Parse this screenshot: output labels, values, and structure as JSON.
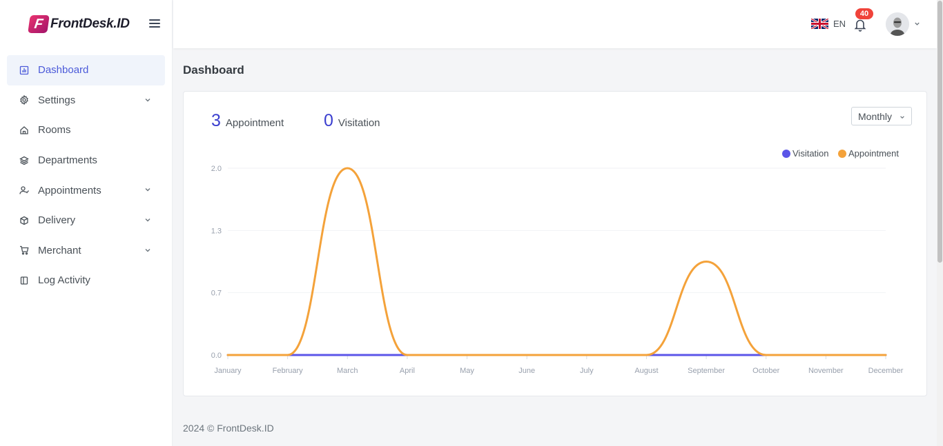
{
  "brand": {
    "logo_letter": "F",
    "name": "FrontDesk.ID"
  },
  "sidebar": {
    "items": [
      {
        "label": "Dashboard",
        "icon": "chart-bar-icon",
        "active": true,
        "has_children": false
      },
      {
        "label": "Settings",
        "icon": "gear-icon",
        "active": false,
        "has_children": true
      },
      {
        "label": "Rooms",
        "icon": "home-icon",
        "active": false,
        "has_children": false
      },
      {
        "label": "Departments",
        "icon": "layers-icon",
        "active": false,
        "has_children": false
      },
      {
        "label": "Appointments",
        "icon": "user-check-icon",
        "active": false,
        "has_children": true
      },
      {
        "label": "Delivery",
        "icon": "package-icon",
        "active": false,
        "has_children": true
      },
      {
        "label": "Merchant",
        "icon": "cart-icon",
        "active": false,
        "has_children": true
      },
      {
        "label": "Log Activity",
        "icon": "book-icon",
        "active": false,
        "has_children": false
      }
    ]
  },
  "topbar": {
    "language": "EN",
    "language_flag": "uk-flag-icon",
    "notification_count": "40"
  },
  "main": {
    "page_title": "Dashboard",
    "stats": [
      {
        "value": "3",
        "label": "Appointment"
      },
      {
        "value": "0",
        "label": "Visitation"
      }
    ],
    "period_select": "Monthly"
  },
  "chart_data": {
    "type": "line",
    "categories": [
      "January",
      "February",
      "March",
      "April",
      "May",
      "June",
      "July",
      "August",
      "September",
      "October",
      "November",
      "December"
    ],
    "y_ticks": [
      "0.0",
      "0.7",
      "1.3",
      "2.0"
    ],
    "ylim": [
      0,
      2
    ],
    "grid": true,
    "legend_position": "top-right",
    "series": [
      {
        "name": "Visitation",
        "color": "#5b55e8",
        "values": [
          0,
          0,
          0,
          0,
          0,
          0,
          0,
          0,
          0,
          0,
          0,
          0
        ]
      },
      {
        "name": "Appointment",
        "color": "#f4a23a",
        "values": [
          0,
          0,
          2,
          0,
          0,
          0,
          0,
          0,
          1,
          0,
          0,
          0
        ]
      }
    ]
  },
  "footer": {
    "text": "2024 © FrontDesk.ID"
  }
}
